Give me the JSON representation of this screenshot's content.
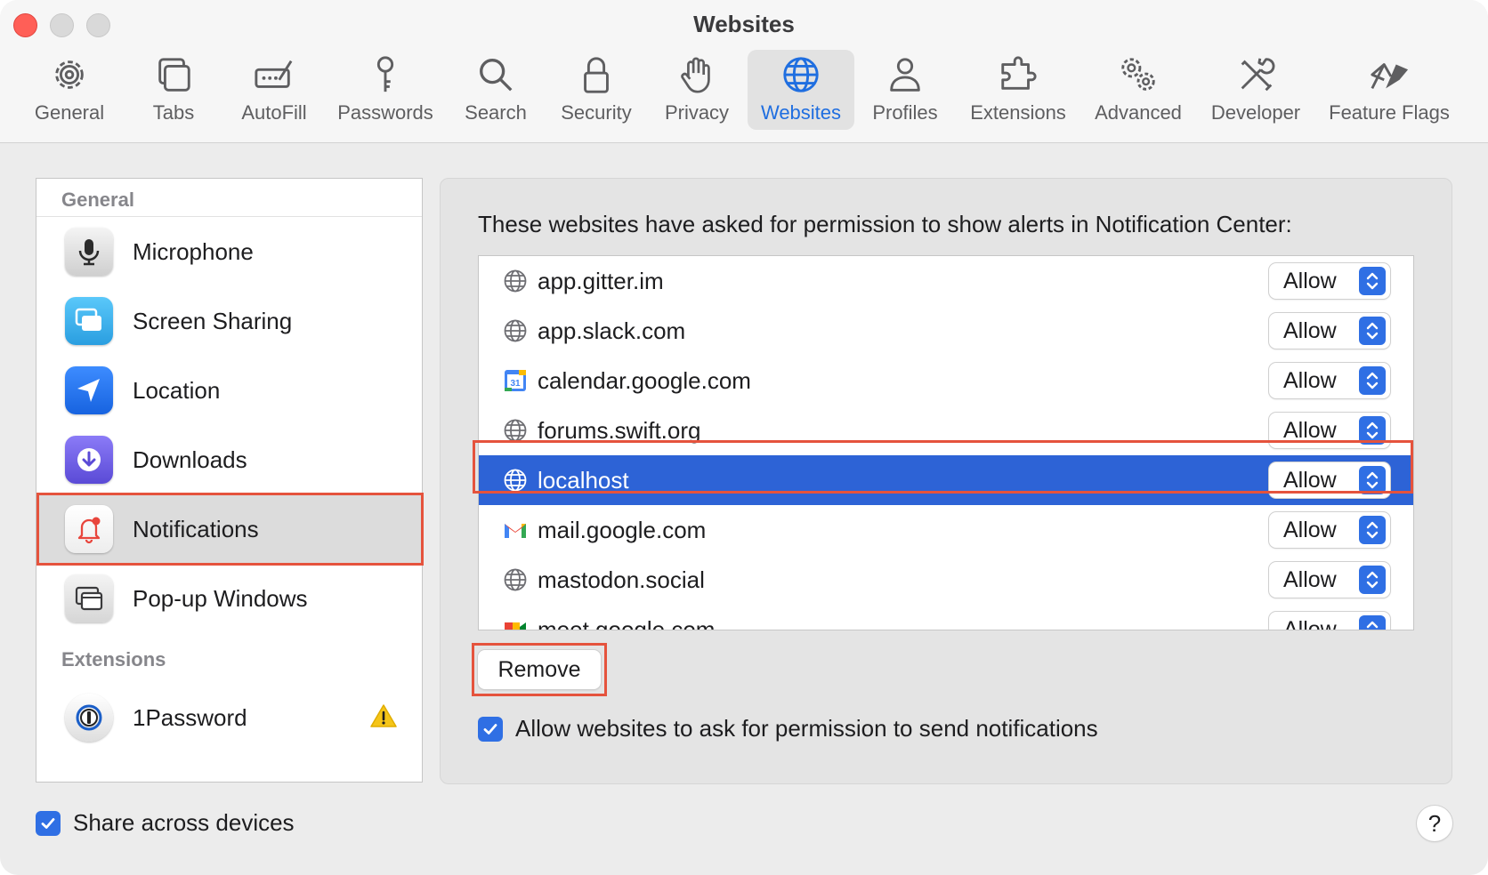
{
  "window": {
    "title": "Websites"
  },
  "toolbar": {
    "items": [
      {
        "label": "General",
        "icon": "gear-icon"
      },
      {
        "label": "Tabs",
        "icon": "tabs-icon"
      },
      {
        "label": "AutoFill",
        "icon": "autofill-icon"
      },
      {
        "label": "Passwords",
        "icon": "key-icon"
      },
      {
        "label": "Search",
        "icon": "search-icon"
      },
      {
        "label": "Security",
        "icon": "lock-icon"
      },
      {
        "label": "Privacy",
        "icon": "hand-icon"
      },
      {
        "label": "Websites",
        "icon": "globe-icon",
        "active": true
      },
      {
        "label": "Profiles",
        "icon": "person-icon"
      },
      {
        "label": "Extensions",
        "icon": "puzzle-icon"
      },
      {
        "label": "Advanced",
        "icon": "gears-icon"
      },
      {
        "label": "Developer",
        "icon": "tools-icon"
      },
      {
        "label": "Feature Flags",
        "icon": "flags-icon"
      }
    ]
  },
  "sidebar": {
    "general_header": "General",
    "items": [
      {
        "label": "Microphone",
        "icon": "microphone-icon"
      },
      {
        "label": "Screen Sharing",
        "icon": "screen-sharing-icon"
      },
      {
        "label": "Location",
        "icon": "location-icon"
      },
      {
        "label": "Downloads",
        "icon": "download-icon"
      },
      {
        "label": "Notifications",
        "icon": "bell-icon",
        "selected": true
      },
      {
        "label": "Pop-up Windows",
        "icon": "popup-window-icon"
      }
    ],
    "extensions_header": "Extensions",
    "extensions": [
      {
        "label": "1Password",
        "icon": "1password-icon",
        "warning": true
      }
    ]
  },
  "main": {
    "description": "These websites have asked for permission to show alerts in Notification Center:",
    "websites": [
      {
        "site": "app.gitter.im",
        "setting": "Allow",
        "icon": "globe-icon"
      },
      {
        "site": "app.slack.com",
        "setting": "Allow",
        "icon": "globe-icon"
      },
      {
        "site": "calendar.google.com",
        "setting": "Allow",
        "icon": "calendar-icon"
      },
      {
        "site": "forums.swift.org",
        "setting": "Allow",
        "icon": "globe-icon"
      },
      {
        "site": "localhost",
        "setting": "Allow",
        "icon": "globe-icon",
        "selected": true
      },
      {
        "site": "mail.google.com",
        "setting": "Allow",
        "icon": "gmail-icon"
      },
      {
        "site": "mastodon.social",
        "setting": "Allow",
        "icon": "globe-icon"
      },
      {
        "site": "meet.google.com",
        "setting": "Allow",
        "icon": "meet-icon"
      }
    ],
    "remove_label": "Remove",
    "allow_ask_label": "Allow websites to ask for permission to send notifications",
    "allow_ask_checked": true
  },
  "footer": {
    "share_label": "Share across devices",
    "share_checked": true,
    "help_label": "?"
  },
  "colors": {
    "accent": "#2f6fe4",
    "selection": "#2d63d6",
    "highlight": "#e5533d"
  }
}
